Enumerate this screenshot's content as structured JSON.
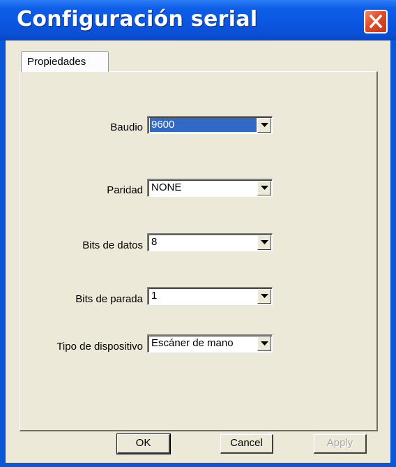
{
  "window": {
    "title": "Configuración serial",
    "close_icon": "close-icon",
    "title_bar_color": "#0a57d8",
    "close_button_color": "#df4b24"
  },
  "tabs": [
    {
      "label": "Propiedades",
      "active": true
    }
  ],
  "fields": {
    "baudio": {
      "label": "Baudio",
      "value": "9600",
      "highlighted": true
    },
    "paridad": {
      "label": "Paridad",
      "value": "NONE"
    },
    "bits_datos": {
      "label": "Bits de datos",
      "value": "8"
    },
    "bits_parada": {
      "label": "Bits de parada",
      "value": "1"
    },
    "tipo_dispositivo": {
      "label": "Tipo de dispositivo",
      "value": "Escáner de mano"
    }
  },
  "dropdown_icon": "chevron-down-icon",
  "buttons": {
    "ok": "OK",
    "cancel": "Cancel",
    "apply": "Apply",
    "apply_enabled": false
  },
  "colors": {
    "dialog_background": "#ece9d8",
    "selection": "#316ac5"
  }
}
